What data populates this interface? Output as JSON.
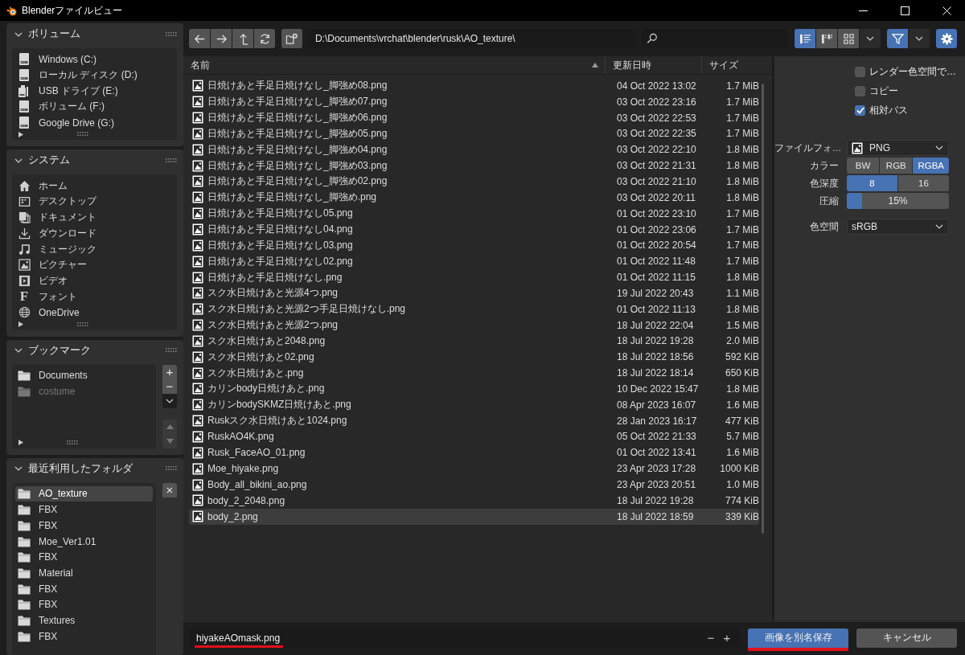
{
  "window": {
    "title": "Blenderファイルビュー"
  },
  "sidebar": {
    "panels": [
      {
        "kind": "volumes",
        "title": "ボリューム",
        "expanded": true,
        "items": [
          {
            "kind": "drive",
            "label": "Windows (C:)",
            "selected": false,
            "disabled": false
          },
          {
            "kind": "drive",
            "label": "ローカル ディスク (D:)",
            "selected": false,
            "disabled": false
          },
          {
            "kind": "usb",
            "label": "USB ドライブ (E:)",
            "selected": false,
            "disabled": false
          },
          {
            "kind": "drive",
            "label": "ボリューム (F:)",
            "selected": false,
            "disabled": false
          },
          {
            "kind": "drive",
            "label": "Google Drive (G:)",
            "selected": false,
            "disabled": false
          }
        ]
      },
      {
        "kind": "system",
        "title": "システム",
        "expanded": true,
        "items": [
          {
            "kind": "home",
            "label": "ホーム",
            "selected": false,
            "disabled": false
          },
          {
            "kind": "desktop",
            "label": "デスクトップ",
            "selected": false,
            "disabled": false
          },
          {
            "kind": "documents",
            "label": "ドキュメント",
            "selected": false,
            "disabled": false
          },
          {
            "kind": "download",
            "label": "ダウンロード",
            "selected": false,
            "disabled": false
          },
          {
            "kind": "music",
            "label": "ミュージック",
            "selected": false,
            "disabled": false
          },
          {
            "kind": "picture",
            "label": "ピクチャー",
            "selected": false,
            "disabled": false
          },
          {
            "kind": "video",
            "label": "ビデオ",
            "selected": false,
            "disabled": false
          },
          {
            "kind": "font",
            "glyph": "F",
            "label": "フォント",
            "selected": false,
            "disabled": false
          },
          {
            "kind": "globe",
            "label": "OneDrive",
            "selected": false,
            "disabled": false
          }
        ]
      },
      {
        "kind": "bookmarks",
        "title": "ブックマーク",
        "expanded": true,
        "side_buttons": [
          "+",
          "−"
        ],
        "items": [
          {
            "kind": "folder",
            "label": "Documents",
            "selected": false,
            "disabled": false
          },
          {
            "kind": "folder",
            "label": "costume",
            "selected": false,
            "disabled": true
          }
        ]
      },
      {
        "kind": "recent",
        "title": "最近利用したフォルダ",
        "expanded": true,
        "side_buttons": [
          "×"
        ],
        "items": [
          {
            "kind": "folder",
            "label": "AO_texture",
            "selected": true,
            "disabled": false
          },
          {
            "kind": "folder",
            "label": "FBX",
            "selected": false,
            "disabled": false
          },
          {
            "kind": "folder",
            "label": "FBX",
            "selected": false,
            "disabled": false
          },
          {
            "kind": "folder",
            "label": "Moe_Ver1.01",
            "selected": false,
            "disabled": false
          },
          {
            "kind": "folder",
            "label": "FBX",
            "selected": false,
            "disabled": false
          },
          {
            "kind": "folder",
            "label": "Material",
            "selected": false,
            "disabled": false
          },
          {
            "kind": "folder",
            "label": "FBX",
            "selected": false,
            "disabled": false
          },
          {
            "kind": "folder",
            "label": "FBX",
            "selected": false,
            "disabled": false
          },
          {
            "kind": "folder",
            "label": "Textures",
            "selected": false,
            "disabled": false
          },
          {
            "kind": "folder",
            "label": "FBX",
            "selected": false,
            "disabled": false
          }
        ]
      }
    ]
  },
  "toolbar": {
    "path": {
      "value": "D:\\Documents\\vrchat\\blender\\rusk\\AO_texture\\"
    },
    "display_modes": [
      {
        "selected": true
      },
      {
        "selected": false
      },
      {
        "selected": false
      }
    ],
    "filter": {
      "on": true
    },
    "settings_button": {
      "on": true
    }
  },
  "file_list": {
    "columns": [
      {
        "label": "名前",
        "sorted": true
      },
      {
        "label": "更新日時",
        "sorted": false
      },
      {
        "label": "サイズ",
        "sorted": false
      }
    ],
    "rows": [
      {
        "name": "日焼けあと手足日焼けなし_脚強め08.png",
        "date": "04 Oct 2022 13:02",
        "size": "1.7 MiB",
        "selected": false
      },
      {
        "name": "日焼けあと手足日焼けなし_脚強め07.png",
        "date": "03 Oct 2022 23:16",
        "size": "1.7 MiB",
        "selected": false
      },
      {
        "name": "日焼けあと手足日焼けなし_脚強め06.png",
        "date": "03 Oct 2022 22:53",
        "size": "1.7 MiB",
        "selected": false
      },
      {
        "name": "日焼けあと手足日焼けなし_脚強め05.png",
        "date": "03 Oct 2022 22:35",
        "size": "1.7 MiB",
        "selected": false
      },
      {
        "name": "日焼けあと手足日焼けなし_脚強め04.png",
        "date": "03 Oct 2022 22:10",
        "size": "1.8 MiB",
        "selected": false
      },
      {
        "name": "日焼けあと手足日焼けなし_脚強め03.png",
        "date": "03 Oct 2022 21:31",
        "size": "1.8 MiB",
        "selected": false
      },
      {
        "name": "日焼けあと手足日焼けなし_脚強め02.png",
        "date": "03 Oct 2022 21:10",
        "size": "1.8 MiB",
        "selected": false
      },
      {
        "name": "日焼けあと手足日焼けなし_脚強め.png",
        "date": "03 Oct 2022 20:11",
        "size": "1.8 MiB",
        "selected": false
      },
      {
        "name": "日焼けあと手足日焼けなし05.png",
        "date": "01 Oct 2022 23:10",
        "size": "1.7 MiB",
        "selected": false
      },
      {
        "name": "日焼けあと手足日焼けなし04.png",
        "date": "01 Oct 2022 23:06",
        "size": "1.7 MiB",
        "selected": false
      },
      {
        "name": "日焼けあと手足日焼けなし03.png",
        "date": "01 Oct 2022 20:54",
        "size": "1.7 MiB",
        "selected": false
      },
      {
        "name": "日焼けあと手足日焼けなし02.png",
        "date": "01 Oct 2022 11:48",
        "size": "1.7 MiB",
        "selected": false
      },
      {
        "name": "日焼けあと手足日焼けなし.png",
        "date": "01 Oct 2022 11:15",
        "size": "1.8 MiB",
        "selected": false
      },
      {
        "name": "スク水日焼けあと光源4つ.png",
        "date": "19 Jul 2022 20:43",
        "size": "1.1 MiB",
        "selected": false
      },
      {
        "name": "スク水日焼けあと光源2つ手足日焼けなし.png",
        "date": "01 Oct 2022 11:13",
        "size": "1.8 MiB",
        "selected": false
      },
      {
        "name": "スク水日焼けあと光源2つ.png",
        "date": "18 Jul 2022 22:04",
        "size": "1.5 MiB",
        "selected": false
      },
      {
        "name": "スク水日焼けあと2048.png",
        "date": "18 Jul 2022 19:28",
        "size": "2.0 MiB",
        "selected": false
      },
      {
        "name": "スク水日焼けあと02.png",
        "date": "18 Jul 2022 18:56",
        "size": "592 KiB",
        "selected": false
      },
      {
        "name": "スク水日焼けあと.png",
        "date": "18 Jul 2022 18:14",
        "size": "650 KiB",
        "selected": false
      },
      {
        "name": "カリンbody日焼けあと.png",
        "date": "10 Dec 2022 15:47",
        "size": "1.8 MiB",
        "selected": false
      },
      {
        "name": "カリンbodySKMZ日焼けあと.png",
        "date": "08 Apr 2023 16:07",
        "size": "1.6 MiB",
        "selected": false
      },
      {
        "name": "Ruskスク水日焼けあと1024.png",
        "date": "28 Jan 2023 16:17",
        "size": "477 KiB",
        "selected": false
      },
      {
        "name": "RuskAO4K.png",
        "date": "05 Oct 2022 21:33",
        "size": "5.7 MiB",
        "selected": false
      },
      {
        "name": "Rusk_FaceAO_01.png",
        "date": "01 Oct 2022 13:41",
        "size": "1.6 MiB",
        "selected": false
      },
      {
        "name": "Moe_hiyake.png",
        "date": "23 Apr 2023 17:28",
        "size": "1000 KiB",
        "selected": false
      },
      {
        "name": "Body_all_bikini_ao.png",
        "date": "23 Apr 2023 20:51",
        "size": "1.0 MiB",
        "selected": false
      },
      {
        "name": "body_2_2048.png",
        "date": "18 Jul 2022 19:28",
        "size": "774 KiB",
        "selected": false
      },
      {
        "name": "body_2.png",
        "date": "18 Jul 2022 18:59",
        "size": "339 KiB",
        "selected": true
      }
    ]
  },
  "options": {
    "checkboxes": [
      {
        "label": "レンダー色空間で…",
        "checked": false
      },
      {
        "label": "コピー",
        "checked": false
      },
      {
        "label": "相対パス",
        "checked": true
      }
    ],
    "settings": [
      {
        "kind": "dropdown",
        "label": "ファイルフォ…",
        "value": "PNG",
        "show_icon": true
      },
      {
        "kind": "segmented",
        "label": "カラー",
        "options": [
          {
            "label": "BW",
            "selected": false
          },
          {
            "label": "RGB",
            "selected": false
          },
          {
            "label": "RGBA",
            "selected": true
          }
        ]
      },
      {
        "kind": "segmented",
        "label": "色深度",
        "options": [
          {
            "label": "8",
            "selected": true
          },
          {
            "label": "16",
            "selected": false
          }
        ]
      },
      {
        "kind": "slider",
        "label": "圧縮",
        "level": 0.15,
        "reading": "15%"
      },
      {
        "kind": "dropdown",
        "label": "色空間",
        "value": "sRGB",
        "show_icon": false
      }
    ]
  },
  "footer": {
    "filename": {
      "value": "hiyakeAOmask.png",
      "marked": true
    },
    "steppers": [
      "−",
      "+"
    ],
    "buttons": [
      {
        "kind": "primary",
        "label": "画像を別名保存",
        "marked": true
      },
      {
        "kind": "secondary",
        "label": "キャンセル",
        "marked": false
      }
    ]
  }
}
